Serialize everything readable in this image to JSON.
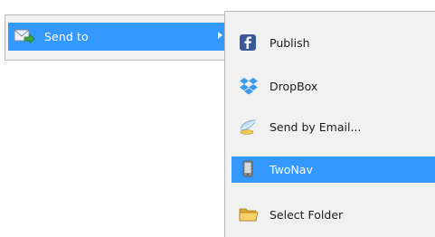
{
  "parent_menu": {
    "send_to": {
      "label": "Send to",
      "icon": "envelope-arrow-icon"
    }
  },
  "submenu": {
    "items": [
      {
        "label": "Publish",
        "icon": "facebook-icon"
      },
      {
        "label": "DropBox",
        "icon": "dropbox-icon"
      },
      {
        "label": "Send by Email...",
        "icon": "email-icon"
      },
      {
        "label": "TwoNav",
        "icon": "device-icon",
        "selected": true
      },
      {
        "label": "Select Folder",
        "icon": "folder-icon"
      }
    ]
  },
  "colors": {
    "highlight": "#3399ff",
    "menu_bg": "#f1f1f1",
    "border": "#b9b9b9",
    "facebook": "#3b5998",
    "dropbox": "#3d9ae8",
    "folder": "#f3c34a"
  }
}
